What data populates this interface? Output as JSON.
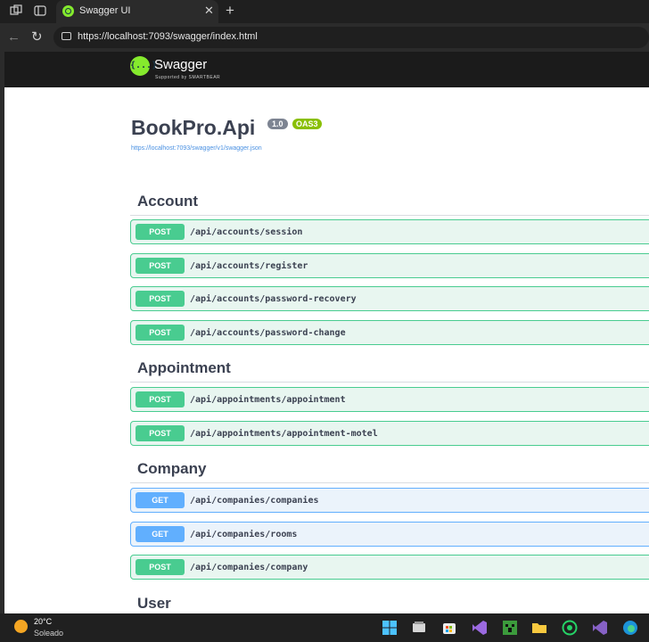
{
  "browser": {
    "tab_title": "Swagger UI",
    "url": "https://localhost:7093/swagger/index.html"
  },
  "swagger_header": {
    "logo_glyph": "{...}",
    "name": "Swagger",
    "supported_by": "Supported by SMARTBEAR"
  },
  "info": {
    "title": "BookPro.Api",
    "version": "1.0",
    "oas": "OAS3",
    "spec_link": "https://localhost:7093/swagger/v1/swagger.json"
  },
  "sections": [
    {
      "name": "Account",
      "operations": [
        {
          "method": "POST",
          "path": "/api/accounts/session"
        },
        {
          "method": "POST",
          "path": "/api/accounts/register"
        },
        {
          "method": "POST",
          "path": "/api/accounts/password-recovery"
        },
        {
          "method": "POST",
          "path": "/api/accounts/password-change"
        }
      ]
    },
    {
      "name": "Appointment",
      "operations": [
        {
          "method": "POST",
          "path": "/api/appointments/appointment"
        },
        {
          "method": "POST",
          "path": "/api/appointments/appointment-motel"
        }
      ]
    },
    {
      "name": "Company",
      "operations": [
        {
          "method": "GET",
          "path": "/api/companies/companies"
        },
        {
          "method": "GET",
          "path": "/api/companies/rooms"
        },
        {
          "method": "POST",
          "path": "/api/companies/company"
        }
      ]
    },
    {
      "name": "User",
      "operations": []
    }
  ],
  "colors": {
    "post": "#49cc90",
    "get": "#61affe",
    "swagger_green": "#85ea2d"
  },
  "taskbar": {
    "temperature": "20°C",
    "condition": "Soleado",
    "apps": [
      "start-icon",
      "file-explorer-icon",
      "store-icon",
      "visual-studio-icon",
      "minecraft-icon",
      "folder-icon",
      "whatsapp-icon",
      "visual-studio-icon-2",
      "edge-icon"
    ]
  }
}
